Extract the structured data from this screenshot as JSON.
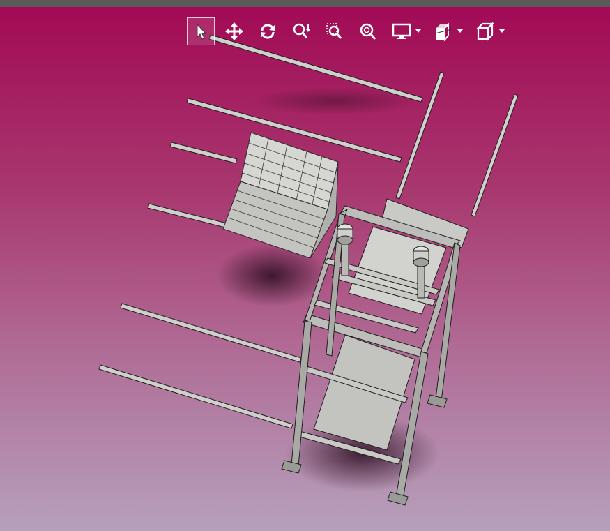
{
  "window": {
    "titlebar_color": "#5a5a5a"
  },
  "viewport": {
    "background_top": "#a20a55",
    "background_bottom": "#b6a0bc",
    "model_color": "#cfcfcb",
    "model_edge_color": "#2a2a2a"
  },
  "toolbar": {
    "tools": [
      {
        "name": "select",
        "icon": "pointer-icon",
        "active": true
      },
      {
        "name": "pan",
        "icon": "move-arrows-icon",
        "active": false
      },
      {
        "name": "rotate",
        "icon": "rotate-icon",
        "active": false
      },
      {
        "name": "zoom-in-out",
        "icon": "zoom-in-out-icon",
        "active": false
      },
      {
        "name": "zoom-window",
        "icon": "zoom-window-icon",
        "active": false
      },
      {
        "name": "zoom-to-fit",
        "icon": "zoom-fit-icon",
        "active": false
      },
      {
        "name": "display-style",
        "icon": "monitor-icon",
        "has_dropdown": true
      },
      {
        "name": "section-view",
        "icon": "section-view-icon",
        "has_dropdown": true
      },
      {
        "name": "view-orientation",
        "icon": "cube-icon",
        "has_dropdown": true
      }
    ]
  }
}
